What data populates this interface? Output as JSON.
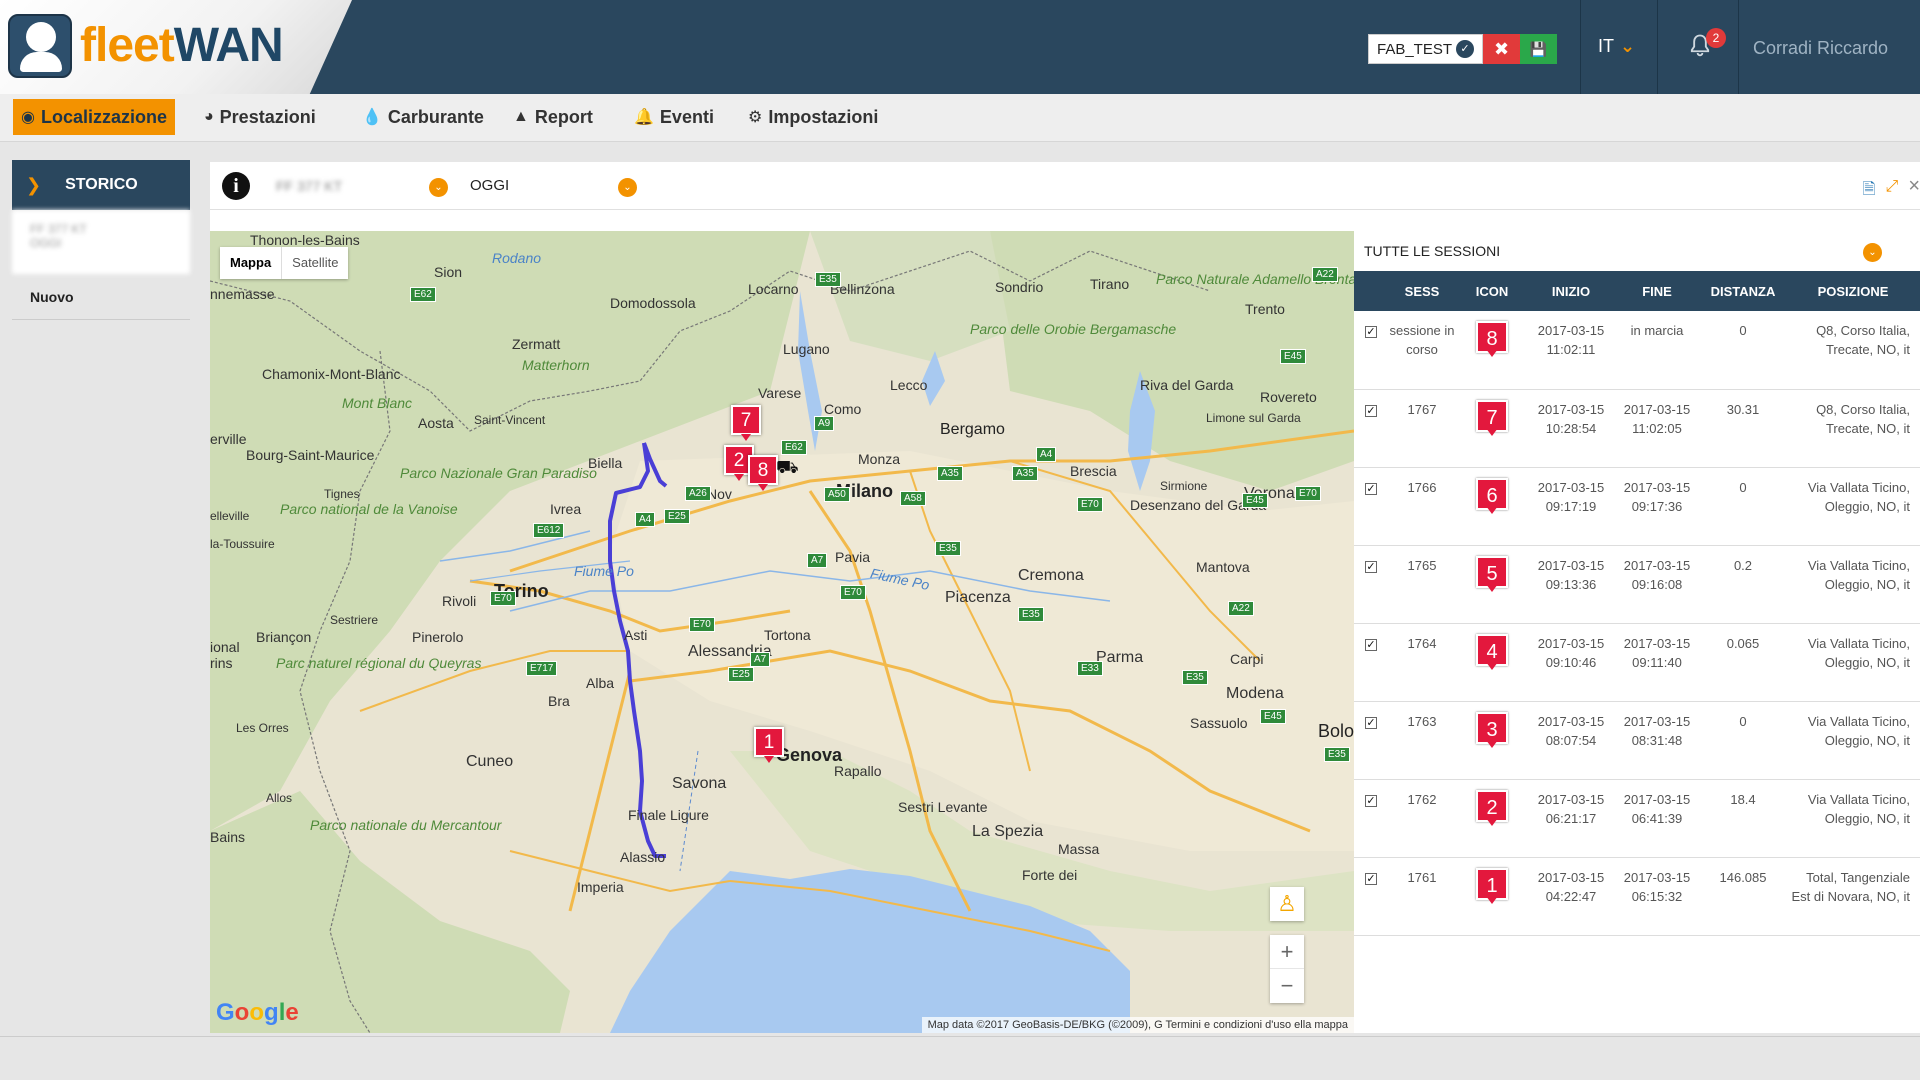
{
  "header": {
    "brand_part1": "fleet",
    "brand_part2": "WAN",
    "fab_select": "FAB_TEST",
    "lang": "IT",
    "notif_count": "2",
    "user": "Corradi Riccardo"
  },
  "nav": {
    "items": [
      {
        "label": "Localizzazione",
        "icon": "dashboard-icon"
      },
      {
        "label": "Prestazioni",
        "icon": "pie-chart-icon"
      },
      {
        "label": "Carburante",
        "icon": "drop-icon"
      },
      {
        "label": "Report",
        "icon": "area-chart-icon"
      },
      {
        "label": "Eventi",
        "icon": "bell-icon"
      },
      {
        "label": "Impostazioni",
        "icon": "gear-icon"
      }
    ]
  },
  "sidebar": {
    "section": "STORICO",
    "entry_line1": "FF 377 KT",
    "entry_line2": "OGGI",
    "nuovo": "Nuovo"
  },
  "filter": {
    "vehicle": "FF 377 KT",
    "period": "OGGI"
  },
  "map": {
    "type_map": "Mappa",
    "type_satellite": "Satellite",
    "attribution": "Map data ©2017 GeoBasis-DE/BKG (©2009), G  Termini e condizioni d'uso   ella mappa",
    "zoom_in": "+",
    "zoom_out": "−",
    "google": [
      "G",
      "o",
      "o",
      "g",
      "l",
      "e"
    ],
    "places": {
      "thonon": "Thonon-les-Bains",
      "sion": "Sion",
      "rodano": "Rodano",
      "nemasse": "nnemasse",
      "domodossola": "Domodossola",
      "locarno": "Locarno",
      "bellinzona": "Bellinzona",
      "sondrio": "Sondrio",
      "tirano": "Tirano",
      "parco_adamello": "Parco Naturale Adamello Brenta",
      "trento": "Trento",
      "zermatt": "Zermatt",
      "matterhorn": "Matterhorn",
      "lugano": "Lugano",
      "parco_orobie": "Parco delle Orobie Bergamasche",
      "chamonix": "Chamonix-Mont-Blanc",
      "mont_blanc": "Mont Blanc",
      "varese": "Varese",
      "como": "Como",
      "lecco": "Lecco",
      "riva": "Riva del Garda",
      "rovereto": "Rovereto",
      "aosta": "Aosta",
      "saint_vincent": "Saint-Vincent",
      "bergamo": "Bergamo",
      "limone": "Limone sul Garda",
      "bourg": "Bourg-Saint-Maurice",
      "biella": "Biella",
      "monza": "Monza",
      "brescia": "Brescia",
      "sirmione": "Sirmione",
      "novara": "Nov",
      "milano": "Milano",
      "verona": "Verona",
      "parco_gp": "Parco Nazionale Gran Paradiso",
      "tignes": "Tignes",
      "ivrea": "Ivrea",
      "parco_vanoise": "Parco national de la Vanoise",
      "desenzano": "Desenzano del Garda",
      "pavia": "Pavia",
      "fiume_po": "Fiume Po",
      "fiume_po2": "Fiume Po",
      "cremona": "Cremona",
      "mantova": "Mantova",
      "torino": "Torino",
      "rivoli": "Rivoli",
      "piacenza": "Piacenza",
      "asti": "Asti",
      "tortona": "Tortona",
      "alessandria": "Alessandria",
      "briancon": "Briançon",
      "sestriere": "Sestriere",
      "pinerolo": "Pinerolo",
      "parma": "Parma",
      "carpi": "Carpi",
      "parco_queyras": "Parc naturel régional du Queyras",
      "alba": "Alba",
      "bra": "Bra",
      "modena": "Modena",
      "sassuolo": "Sassuolo",
      "les_orres": "Les Orres",
      "genova": "Genova",
      "bolo": "Bolo",
      "cuneo": "Cuneo",
      "savona": "Savona",
      "rapallo": "Rapallo",
      "finale": "Finale Ligure",
      "sestri": "Sestri Levante",
      "allos": "Allos",
      "parco_mercantour": "Parco nationale du Mercantour",
      "la_spezia": "La Spezia",
      "massa": "Massa",
      "alassio": "Alassio",
      "forte": "Forte dei",
      "imperia": "Imperia",
      "bains": "Bains",
      "erville": "erville",
      "elleville": "elleville",
      "toussuire": "la-Toussuire",
      "ional": "ional",
      "rins": "rins"
    }
  },
  "sessions": {
    "title": "TUTTE LE SESSIONI",
    "columns": [
      "SESS",
      "ICON",
      "INIZIO",
      "FINE",
      "DISTANZA",
      "POSIZIONE"
    ],
    "rows": [
      {
        "sess": "sessione in corso",
        "icon": "8",
        "inizio": "2017-03-15 11:02:11",
        "fine": "in marcia",
        "distanza": "0",
        "posizione": "Q8, Corso Italia, Trecate, NO, it"
      },
      {
        "sess": "1767",
        "icon": "7",
        "inizio": "2017-03-15 10:28:54",
        "fine": "2017-03-15 11:02:05",
        "distanza": "30.31",
        "posizione": "Q8, Corso Italia, Trecate, NO, it"
      },
      {
        "sess": "1766",
        "icon": "6",
        "inizio": "2017-03-15 09:17:19",
        "fine": "2017-03-15 09:17:36",
        "distanza": "0",
        "posizione": "Via Vallata Ticino, Oleggio, NO, it"
      },
      {
        "sess": "1765",
        "icon": "5",
        "inizio": "2017-03-15 09:13:36",
        "fine": "2017-03-15 09:16:08",
        "distanza": "0.2",
        "posizione": "Via Vallata Ticino, Oleggio, NO, it"
      },
      {
        "sess": "1764",
        "icon": "4",
        "inizio": "2017-03-15 09:10:46",
        "fine": "2017-03-15 09:11:40",
        "distanza": "0.065",
        "posizione": "Via Vallata Ticino, Oleggio, NO, it"
      },
      {
        "sess": "1763",
        "icon": "3",
        "inizio": "2017-03-15 08:07:54",
        "fine": "2017-03-15 08:31:48",
        "distanza": "0",
        "posizione": "Via Vallata Ticino, Oleggio, NO, it"
      },
      {
        "sess": "1762",
        "icon": "2",
        "inizio": "2017-03-15 06:21:17",
        "fine": "2017-03-15 06:41:39",
        "distanza": "18.4",
        "posizione": "Via Vallata Ticino, Oleggio, NO, it"
      },
      {
        "sess": "1761",
        "icon": "1",
        "inizio": "2017-03-15 04:22:47",
        "fine": "2017-03-15 06:15:32",
        "distanza": "146.085",
        "posizione": "Total, Tangenziale Est di Novara, NO, it"
      }
    ]
  },
  "map_markers": [
    "7",
    "2",
    "8",
    "1"
  ],
  "colors": {
    "accent": "#f39200",
    "navy": "#2a475e",
    "marker": "#e3183d",
    "route": "#4a3fd6"
  }
}
